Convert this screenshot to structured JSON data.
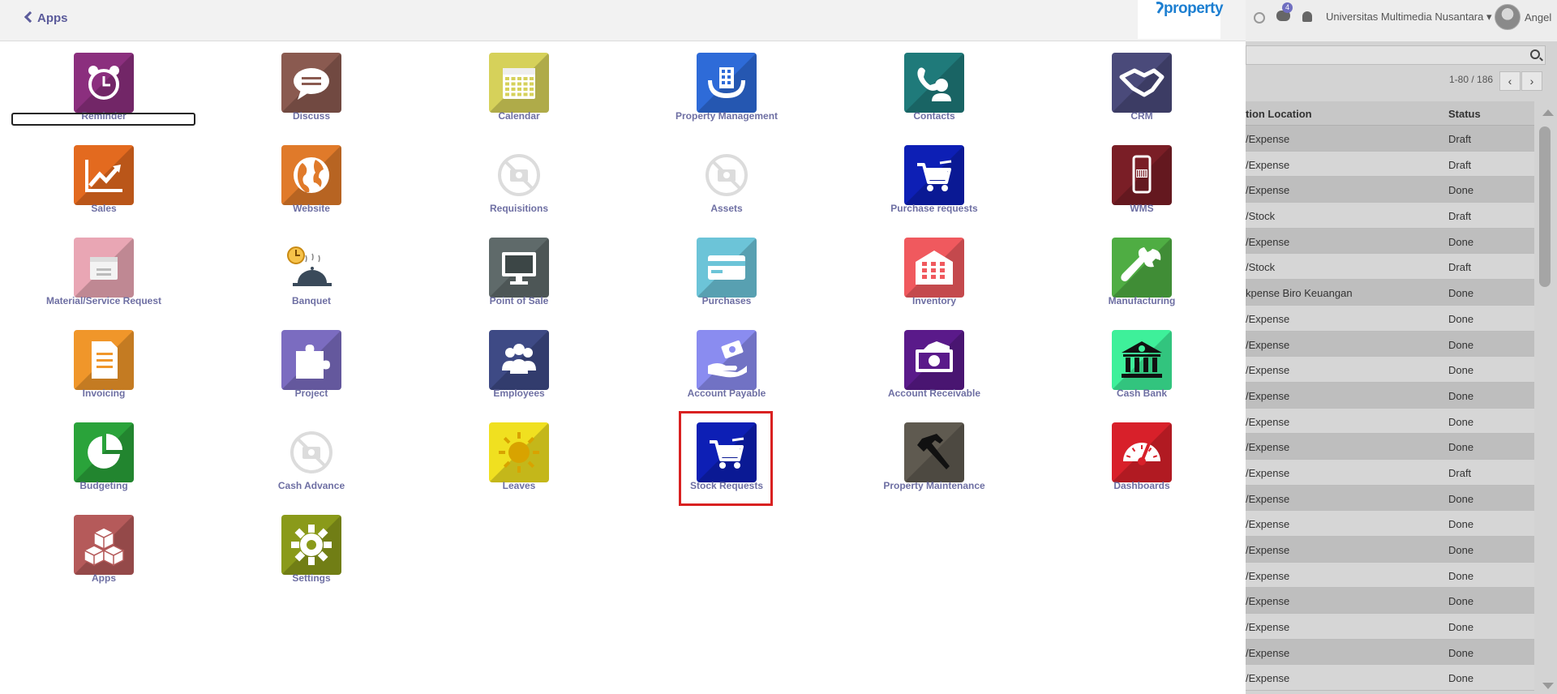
{
  "header": {
    "back_label": "Apps",
    "brand": "property"
  },
  "apps": [
    {
      "label": "Reminder",
      "color": "#8b2f7e",
      "icon": "alarm-clock-icon"
    },
    {
      "label": "Discuss",
      "color": "#8a5a50",
      "icon": "chat-bubble-icon"
    },
    {
      "label": "Calendar",
      "color": "#d6d15a",
      "icon": "calendar-icon"
    },
    {
      "label": "Property Management",
      "color": "#2e6bd8",
      "icon": "building-hands-icon"
    },
    {
      "label": "Contacts",
      "color": "#1f7a7a",
      "icon": "phone-person-icon"
    },
    {
      "label": "CRM",
      "color": "#4a4a7a",
      "icon": "handshake-icon"
    },
    {
      "label": "Sales",
      "color": "#e36a1f",
      "icon": "trend-chart-icon"
    },
    {
      "label": "Website",
      "color": "#e07a2a",
      "icon": "globe-icon"
    },
    {
      "label": "Requisitions",
      "color": "#ffffff",
      "icon": "no-image-icon"
    },
    {
      "label": "Assets",
      "color": "#ffffff",
      "icon": "no-image-icon"
    },
    {
      "label": "Purchase requests",
      "color": "#0d1fb5",
      "icon": "cart-icon"
    },
    {
      "label": "WMS",
      "color": "#7a1e26",
      "icon": "mobile-barcode-icon"
    },
    {
      "label": "Material/Service Request",
      "color": "#e9a6b4",
      "icon": "card-icon"
    },
    {
      "label": "Banquet",
      "color": "#ffffff",
      "icon": "banquet-icon"
    },
    {
      "label": "Point of Sale",
      "color": "#5f6a6a",
      "icon": "monitor-icon"
    },
    {
      "label": "Purchases",
      "color": "#6cc4d8",
      "icon": "credit-card-icon"
    },
    {
      "label": "Inventory",
      "color": "#f0595e",
      "icon": "warehouse-icon"
    },
    {
      "label": "Manufacturing",
      "color": "#4fad43",
      "icon": "wrench-icon"
    },
    {
      "label": "Invoicing",
      "color": "#f0962a",
      "icon": "document-icon"
    },
    {
      "label": "Project",
      "color": "#7b6cc0",
      "icon": "puzzle-icon"
    },
    {
      "label": "Employees",
      "color": "#3e4a85",
      "icon": "people-icon"
    },
    {
      "label": "Account Payable",
      "color": "#8a8cf0",
      "icon": "hand-money-icon"
    },
    {
      "label": "Account Receivable",
      "color": "#5a1a8a",
      "icon": "money-icon"
    },
    {
      "label": "Cash Bank",
      "color": "#3ef09a",
      "icon": "bank-icon"
    },
    {
      "label": "Budgeting",
      "color": "#2aa33a",
      "icon": "pie-chart-icon"
    },
    {
      "label": "Cash Advance",
      "color": "#ffffff",
      "icon": "no-image-icon"
    },
    {
      "label": "Leaves",
      "color": "#f0e020",
      "icon": "sun-icon"
    },
    {
      "label": "Stock Requests",
      "color": "#0d1fb5",
      "icon": "cart-icon"
    },
    {
      "label": "Property Maintenance",
      "color": "#5f5a50",
      "icon": "hammer-icon"
    },
    {
      "label": "Dashboards",
      "color": "#d8202a",
      "icon": "gauge-icon"
    },
    {
      "label": "Apps",
      "color": "#b55a5a",
      "icon": "cubes-icon"
    },
    {
      "label": "Settings",
      "color": "#8a9a1a",
      "icon": "gear-icon"
    }
  ],
  "topbar": {
    "chat_count": "4",
    "company": "Universitas Multimedia Nusantara",
    "user": "Angel"
  },
  "list": {
    "pager": "1-80 / 186",
    "col_location": "tion Location",
    "col_status": "Status",
    "rows": [
      {
        "location": "/Expense",
        "status": "Draft"
      },
      {
        "location": "/Expense",
        "status": "Draft"
      },
      {
        "location": "/Expense",
        "status": "Done"
      },
      {
        "location": "/Stock",
        "status": "Draft"
      },
      {
        "location": "/Expense",
        "status": "Done"
      },
      {
        "location": "/Stock",
        "status": "Draft"
      },
      {
        "location": "kpense Biro Keuangan",
        "status": "Done"
      },
      {
        "location": "/Expense",
        "status": "Done"
      },
      {
        "location": "/Expense",
        "status": "Done"
      },
      {
        "location": "/Expense",
        "status": "Done"
      },
      {
        "location": "/Expense",
        "status": "Done"
      },
      {
        "location": "/Expense",
        "status": "Done"
      },
      {
        "location": "/Expense",
        "status": "Done"
      },
      {
        "location": "/Expense",
        "status": "Draft"
      },
      {
        "location": "/Expense",
        "status": "Done"
      },
      {
        "location": "/Expense",
        "status": "Done"
      },
      {
        "location": "/Expense",
        "status": "Done"
      },
      {
        "location": "/Expense",
        "status": "Done"
      },
      {
        "location": "/Expense",
        "status": "Done"
      },
      {
        "location": "/Expense",
        "status": "Done"
      },
      {
        "location": "/Expense",
        "status": "Done"
      },
      {
        "location": "/Expense",
        "status": "Done"
      }
    ]
  }
}
